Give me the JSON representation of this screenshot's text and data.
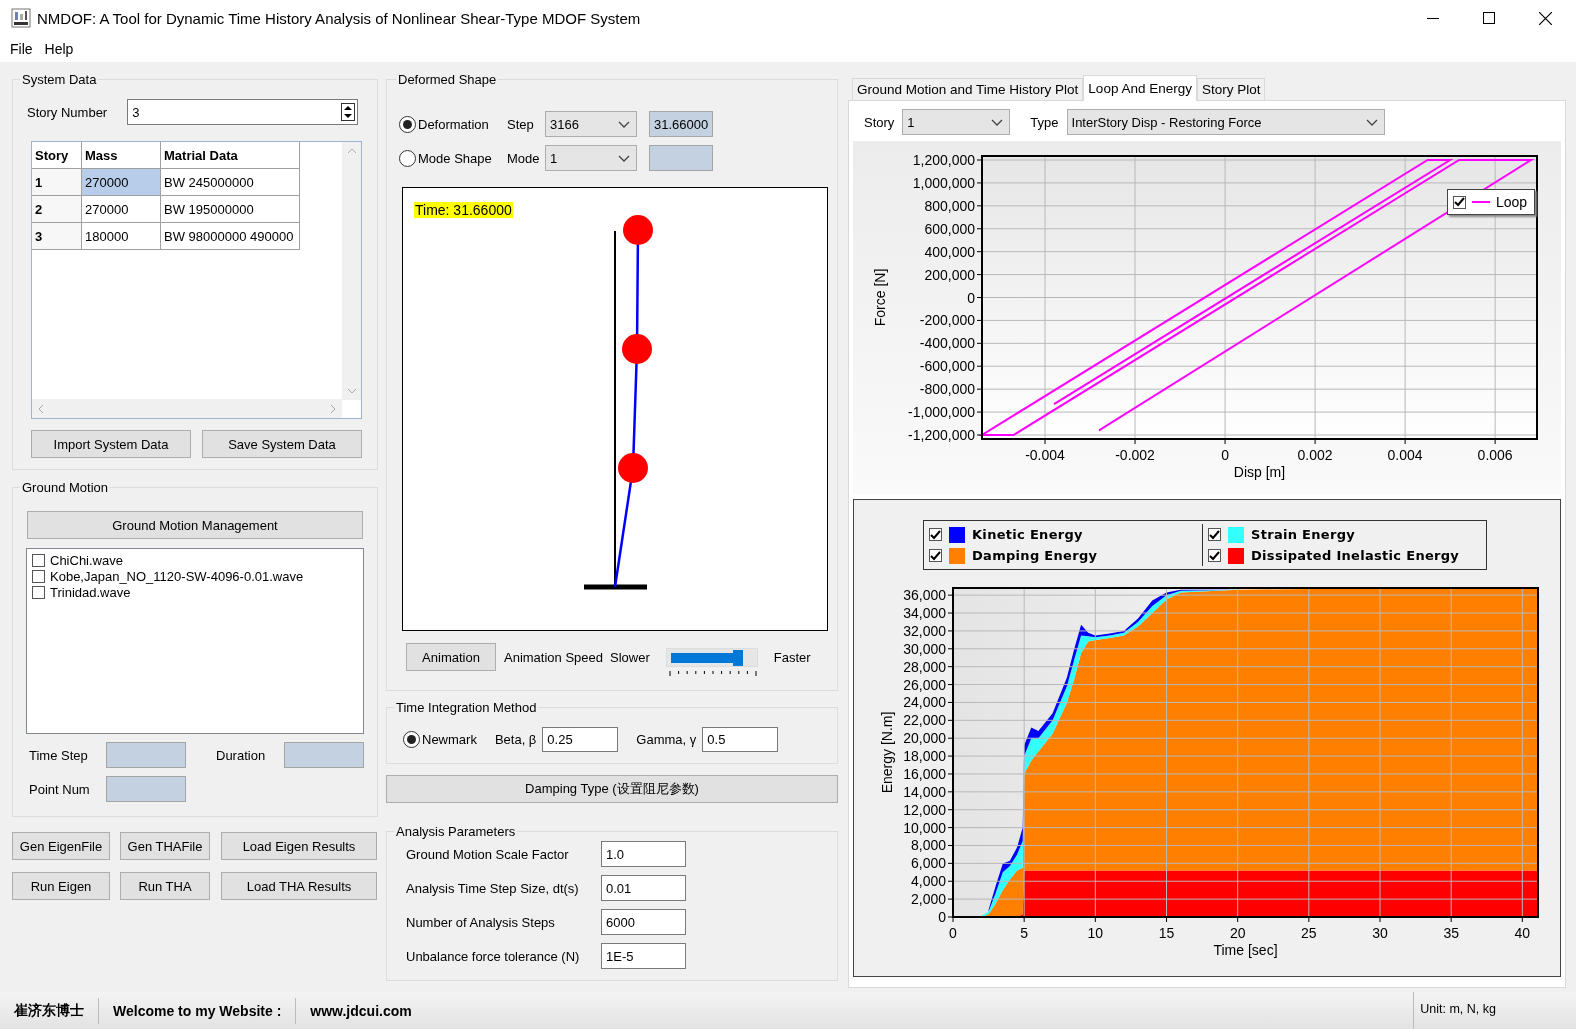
{
  "window": {
    "title": "NMDOF: A Tool for Dynamic Time History Analysis of Nonlinear Shear-Type MDOF System"
  },
  "menu": [
    {
      "label": "File"
    },
    {
      "label": "Help"
    }
  ],
  "system_data": {
    "title": "System Data",
    "story_number_label": "Story Number",
    "story_number": "3",
    "table": {
      "columns": [
        "Story",
        "Mass",
        "Matrial Data"
      ],
      "rows": [
        {
          "cells": [
            {
              "text": "1",
              "selected": false
            },
            {
              "text": "270000",
              "selected": true
            },
            {
              "text": "BW 245000000",
              "selected": false
            }
          ]
        },
        {
          "cells": [
            {
              "text": "2",
              "selected": false
            },
            {
              "text": "270000",
              "selected": false
            },
            {
              "text": "BW 195000000",
              "selected": false
            }
          ]
        },
        {
          "cells": [
            {
              "text": "3",
              "selected": false
            },
            {
              "text": "180000",
              "selected": false
            },
            {
              "text": "BW 98000000 490000",
              "selected": false
            }
          ]
        }
      ]
    },
    "buttons": [
      "Import System Data",
      "Save System Data"
    ]
  },
  "ground_motion": {
    "title": "Ground Motion",
    "manage_button": "Ground Motion Management",
    "files": [
      {
        "name": "ChiChi.wave",
        "checked": false
      },
      {
        "name": "Kobe,Japan_NO_1120-SW-4096-0.01.wave",
        "checked": false
      },
      {
        "name": "Trinidad.wave",
        "checked": false
      }
    ],
    "fields": [
      {
        "label": "Time Step",
        "disabled": true
      },
      {
        "label": "Duration",
        "disabled": true
      },
      {
        "label": "Point Num",
        "disabled": true
      }
    ]
  },
  "actions": [
    {
      "buttons": [
        "Gen EigenFile",
        "Gen THAFile",
        "Load Eigen Results"
      ]
    },
    {
      "buttons": [
        "Run Eigen",
        "Run THA",
        "Load THA Results"
      ]
    }
  ],
  "deformed_shape": {
    "title": "Deformed Shape",
    "modes": [
      {
        "label": "Deformation",
        "selected": true,
        "selector_label": "Step",
        "selector_value": "3166",
        "readout": "31.66000"
      },
      {
        "label": "Mode Shape",
        "selected": false,
        "selector_label": "Mode",
        "selector_value": "1"
      }
    ],
    "time_label": "Time: 31.66000",
    "animation_button": "Animation",
    "speed_label": "Animation Speed",
    "slower_label": "Slower",
    "faster_label": "Faster",
    "speed": {
      "level": 0.8
    }
  },
  "time_integration": {
    "title": "Time Integration Method",
    "methods": [
      {
        "label": "Newmark",
        "selected": true
      }
    ],
    "params": [
      {
        "label": "Beta, β",
        "value": "0.25"
      },
      {
        "label": "Gamma, γ",
        "value": "0.5"
      }
    ]
  },
  "damping_button": "Damping Type (设置阻尼参数)",
  "analysis_parameters": {
    "title": "Analysis Parameters",
    "fields": [
      {
        "label": "Ground Motion Scale Factor",
        "value": "1.0"
      },
      {
        "label": "Analysis Time Step Size, dt(s)",
        "value": "0.01"
      },
      {
        "label": "Number of Analysis Steps",
        "value": "6000"
      },
      {
        "label": "Unbalance force tolerance (N)",
        "value": "1E-5"
      }
    ]
  },
  "results": {
    "tabs": [
      {
        "label": "Ground Motion and Time History Plot",
        "selected": false
      },
      {
        "label": "Loop And Energy",
        "selected": true
      },
      {
        "label": "Story Plot",
        "selected": false
      }
    ],
    "story_label": "Story",
    "story_value": "1",
    "type_label": "Type",
    "type_value": "InterStory Disp - Restoring Force",
    "loop_chart": {
      "legend": [
        {
          "checked": true
        }
      ],
      "chart_data": {
        "type": "line",
        "grid": true,
        "legend": "upper right",
        "xlabel": "Disp [m]",
        "ylabel": "Force [N]",
        "x": [
          -0.0028,
          0.0068,
          0.0052,
          -0.0047,
          -0.0054,
          0.0045,
          0.005,
          -0.0038
        ],
        "series": [
          {
            "name": "Loop",
            "color": "#ff00ff",
            "values": [
              -1160000,
              1200000,
              1200000,
              -1200000,
              -1200000,
              1200000,
              1200000,
              -930000
            ]
          }
        ],
        "xlim": [
          -0.0054,
          0.00693
        ],
        "ylim": [
          -1235000,
          1235000
        ],
        "xticks": [
          -0.004,
          -0.002,
          0,
          0.002,
          0.004,
          0.006
        ],
        "yticks": [
          {
            "value": 1200000,
            "label": "1,200,000"
          },
          {
            "value": 1000000,
            "label": "1,000,000"
          },
          {
            "value": 800000,
            "label": "800,000"
          },
          {
            "value": 600000,
            "label": "600,000"
          },
          {
            "value": 400000,
            "label": "400,000"
          },
          {
            "value": 200000,
            "label": "200,000"
          },
          {
            "value": 0,
            "label": "0"
          },
          {
            "value": -200000,
            "label": "-200,000"
          },
          {
            "value": -400000,
            "label": "-400,000"
          },
          {
            "value": -600000,
            "label": "-600,000"
          },
          {
            "value": -800000,
            "label": "-800,000"
          },
          {
            "value": -1000000,
            "label": "-1,000,000"
          },
          {
            "value": -1200000,
            "label": "-1,200,000"
          }
        ]
      }
    },
    "energy_chart": {
      "legend": [
        {
          "checked": true
        },
        {
          "checked": true
        },
        {
          "checked": true
        },
        {
          "checked": true
        }
      ],
      "chart_data": {
        "type": "area",
        "stacked": true,
        "grid": true,
        "legend": "top",
        "xlabel": "Time [sec]",
        "ylabel": "Energy [N.m]",
        "x": [
          0,
          1,
          2,
          2.5,
          3,
          3.5,
          4,
          4.5,
          4.9,
          5,
          5.5,
          6,
          7,
          8,
          8.5,
          9,
          9.5,
          10,
          11,
          12,
          13,
          14,
          15,
          16,
          20,
          25,
          30,
          35,
          40,
          41.1
        ],
        "series": [
          {
            "name": "Dissipated Inelastic Energy",
            "color": "#ff0000",
            "values": [
              0,
              0,
              0,
              0,
              0,
              0,
              0,
              0,
              300,
              5200,
              5200,
              5200,
              5200,
              5200,
              5200,
              5200,
              5200,
              5200,
              5200,
              5200,
              5200,
              5200,
              5200,
              5200,
              5200,
              5200,
              5200,
              5200,
              5200,
              5200
            ]
          },
          {
            "name": "Damping Energy",
            "color": "#ff8000",
            "values": [
              0,
              0,
              0,
              300,
              1500,
              3000,
              4200,
              5200,
              5200,
              10800,
              12300,
              13300,
              15300,
              18800,
              21300,
              24300,
              25600,
              25800,
              26000,
              26300,
              27300,
              28800,
              30300,
              31100,
              31400,
              31500,
              31500,
              31500,
              31500,
              31500
            ]
          },
          {
            "name": "Strain Energy",
            "color": "#33ffff",
            "values": [
              null,
              null,
              100,
              300,
              1200,
              2000,
              1500,
              1800,
              3000,
              2000,
              2500,
              1500,
              1500,
              1800,
              2200,
              2000,
              600,
              300,
              300,
              300,
              500,
              800,
              500,
              200,
              0,
              0,
              0,
              0,
              0,
              0
            ]
          },
          {
            "name": "Kinetic Energy",
            "color": "#0000ff",
            "values": [
              null,
              null,
              null,
              200,
              800,
              1000,
              600,
              800,
              1500,
              1200,
              1200,
              800,
              800,
              1000,
              1200,
              1200,
              400,
              200,
              200,
              200,
              400,
              600,
              300,
              100,
              0,
              0,
              0,
              0,
              0,
              0
            ]
          }
        ],
        "xlim": [
          0,
          41.1
        ],
        "ylim": [
          0,
          36800
        ],
        "xticks": [
          0,
          5,
          10,
          15,
          20,
          25,
          30,
          35,
          40
        ],
        "yticks": [
          {
            "value": 36000,
            "label": "36,000"
          },
          {
            "value": 34000,
            "label": "34,000"
          },
          {
            "value": 32000,
            "label": "32,000"
          },
          {
            "value": 30000,
            "label": "30,000"
          },
          {
            "value": 28000,
            "label": "28,000"
          },
          {
            "value": 26000,
            "label": "26,000"
          },
          {
            "value": 24000,
            "label": "24,000"
          },
          {
            "value": 22000,
            "label": "22,000"
          },
          {
            "value": 20000,
            "label": "20,000"
          },
          {
            "value": 18000,
            "label": "18,000"
          },
          {
            "value": 16000,
            "label": "16,000"
          },
          {
            "value": 14000,
            "label": "14,000"
          },
          {
            "value": 12000,
            "label": "12,000"
          },
          {
            "value": 10000,
            "label": "10,000"
          },
          {
            "value": 8000,
            "label": "8,000"
          },
          {
            "value": 6000,
            "label": "6,000"
          },
          {
            "value": 4000,
            "label": "4,000"
          },
          {
            "value": 2000,
            "label": "2,000"
          },
          {
            "value": 0,
            "label": "0"
          }
        ]
      }
    }
  },
  "status_bar": {
    "items": [
      "崔济东博士",
      "Welcome to my Website :",
      "www.jdcui.com"
    ],
    "units": "Unit: m, N, kg"
  }
}
